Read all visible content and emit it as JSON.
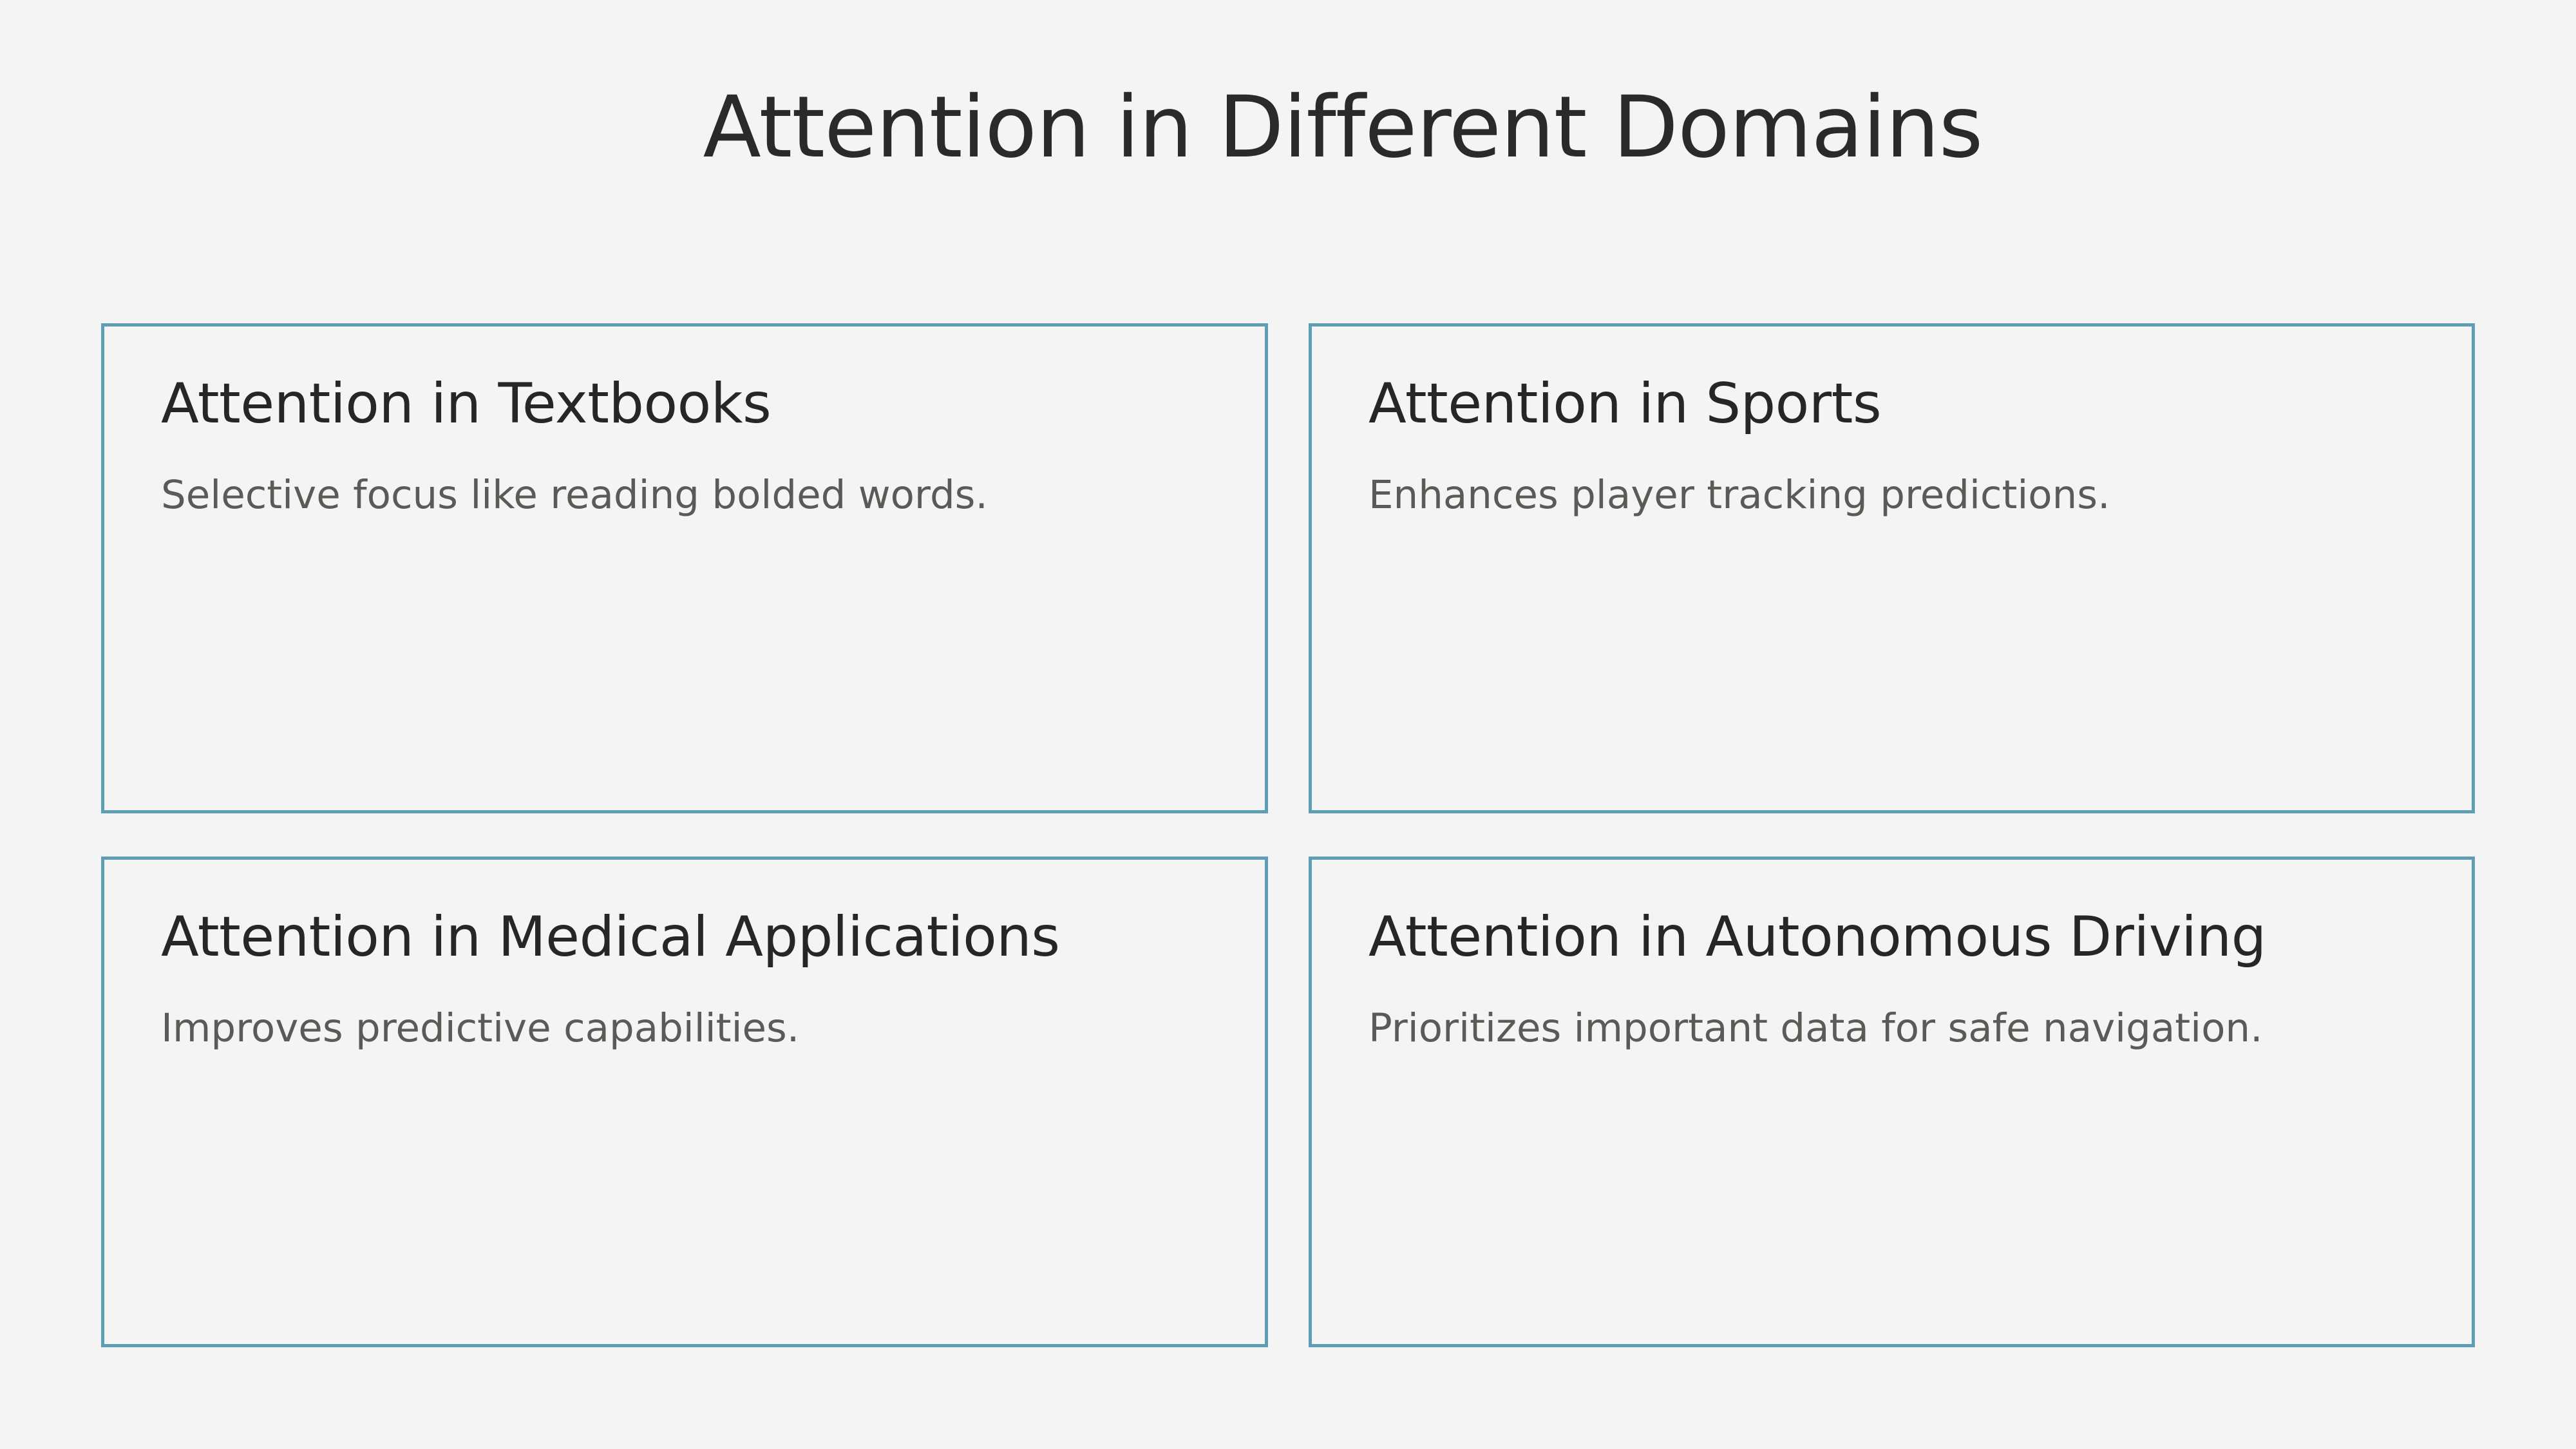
{
  "slide": {
    "title": "Attention in Different Domains",
    "cards": [
      {
        "title": "Attention in Textbooks",
        "description": "Selective focus like reading bolded words."
      },
      {
        "title": "Attention in Sports",
        "description": "Enhances player tracking predictions."
      },
      {
        "title": "Attention in Medical Applications",
        "description": "Improves predictive capabilities."
      },
      {
        "title": "Attention in Autonomous Driving",
        "description": "Prioritizes important data for safe navigation."
      }
    ]
  },
  "colors": {
    "background": "#f4f4f4",
    "card_border": "#5e9eb5",
    "title_text": "#262624",
    "description_text": "#5a5a56"
  }
}
